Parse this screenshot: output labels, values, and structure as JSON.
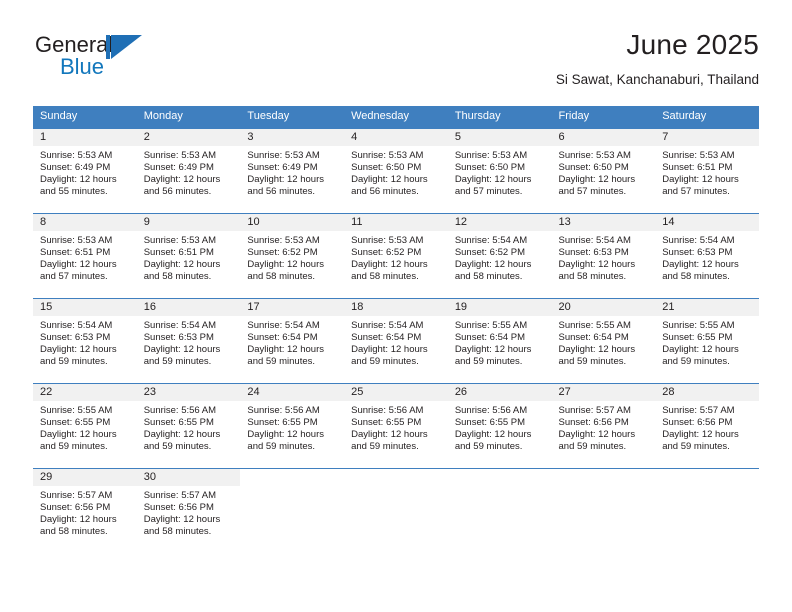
{
  "brand": {
    "name_primary": "General",
    "name_secondary": "Blue",
    "mark": "blue-triangle-logo",
    "color_primary": "#231f20",
    "color_secondary": "#1277bc"
  },
  "header": {
    "title": "June 2025",
    "subtitle": "Si Sawat, Kanchanaburi, Thailand"
  },
  "theme": {
    "header_bg": "#3f7fbf",
    "header_text": "#ffffff",
    "daynum_bg": "#f1f1f1",
    "row_divider": "#3f7fbf",
    "body_text": "#231f20"
  },
  "calendar": {
    "weekdays": [
      "Sunday",
      "Monday",
      "Tuesday",
      "Wednesday",
      "Thursday",
      "Friday",
      "Saturday"
    ],
    "weeks": [
      [
        {
          "day": "1",
          "sunrise": "Sunrise: 5:53 AM",
          "sunset": "Sunset: 6:49 PM",
          "daylight_line1": "Daylight: 12 hours",
          "daylight_line2": "and 55 minutes."
        },
        {
          "day": "2",
          "sunrise": "Sunrise: 5:53 AM",
          "sunset": "Sunset: 6:49 PM",
          "daylight_line1": "Daylight: 12 hours",
          "daylight_line2": "and 56 minutes."
        },
        {
          "day": "3",
          "sunrise": "Sunrise: 5:53 AM",
          "sunset": "Sunset: 6:49 PM",
          "daylight_line1": "Daylight: 12 hours",
          "daylight_line2": "and 56 minutes."
        },
        {
          "day": "4",
          "sunrise": "Sunrise: 5:53 AM",
          "sunset": "Sunset: 6:50 PM",
          "daylight_line1": "Daylight: 12 hours",
          "daylight_line2": "and 56 minutes."
        },
        {
          "day": "5",
          "sunrise": "Sunrise: 5:53 AM",
          "sunset": "Sunset: 6:50 PM",
          "daylight_line1": "Daylight: 12 hours",
          "daylight_line2": "and 57 minutes."
        },
        {
          "day": "6",
          "sunrise": "Sunrise: 5:53 AM",
          "sunset": "Sunset: 6:50 PM",
          "daylight_line1": "Daylight: 12 hours",
          "daylight_line2": "and 57 minutes."
        },
        {
          "day": "7",
          "sunrise": "Sunrise: 5:53 AM",
          "sunset": "Sunset: 6:51 PM",
          "daylight_line1": "Daylight: 12 hours",
          "daylight_line2": "and 57 minutes."
        }
      ],
      [
        {
          "day": "8",
          "sunrise": "Sunrise: 5:53 AM",
          "sunset": "Sunset: 6:51 PM",
          "daylight_line1": "Daylight: 12 hours",
          "daylight_line2": "and 57 minutes."
        },
        {
          "day": "9",
          "sunrise": "Sunrise: 5:53 AM",
          "sunset": "Sunset: 6:51 PM",
          "daylight_line1": "Daylight: 12 hours",
          "daylight_line2": "and 58 minutes."
        },
        {
          "day": "10",
          "sunrise": "Sunrise: 5:53 AM",
          "sunset": "Sunset: 6:52 PM",
          "daylight_line1": "Daylight: 12 hours",
          "daylight_line2": "and 58 minutes."
        },
        {
          "day": "11",
          "sunrise": "Sunrise: 5:53 AM",
          "sunset": "Sunset: 6:52 PM",
          "daylight_line1": "Daylight: 12 hours",
          "daylight_line2": "and 58 minutes."
        },
        {
          "day": "12",
          "sunrise": "Sunrise: 5:54 AM",
          "sunset": "Sunset: 6:52 PM",
          "daylight_line1": "Daylight: 12 hours",
          "daylight_line2": "and 58 minutes."
        },
        {
          "day": "13",
          "sunrise": "Sunrise: 5:54 AM",
          "sunset": "Sunset: 6:53 PM",
          "daylight_line1": "Daylight: 12 hours",
          "daylight_line2": "and 58 minutes."
        },
        {
          "day": "14",
          "sunrise": "Sunrise: 5:54 AM",
          "sunset": "Sunset: 6:53 PM",
          "daylight_line1": "Daylight: 12 hours",
          "daylight_line2": "and 58 minutes."
        }
      ],
      [
        {
          "day": "15",
          "sunrise": "Sunrise: 5:54 AM",
          "sunset": "Sunset: 6:53 PM",
          "daylight_line1": "Daylight: 12 hours",
          "daylight_line2": "and 59 minutes."
        },
        {
          "day": "16",
          "sunrise": "Sunrise: 5:54 AM",
          "sunset": "Sunset: 6:53 PM",
          "daylight_line1": "Daylight: 12 hours",
          "daylight_line2": "and 59 minutes."
        },
        {
          "day": "17",
          "sunrise": "Sunrise: 5:54 AM",
          "sunset": "Sunset: 6:54 PM",
          "daylight_line1": "Daylight: 12 hours",
          "daylight_line2": "and 59 minutes."
        },
        {
          "day": "18",
          "sunrise": "Sunrise: 5:54 AM",
          "sunset": "Sunset: 6:54 PM",
          "daylight_line1": "Daylight: 12 hours",
          "daylight_line2": "and 59 minutes."
        },
        {
          "day": "19",
          "sunrise": "Sunrise: 5:55 AM",
          "sunset": "Sunset: 6:54 PM",
          "daylight_line1": "Daylight: 12 hours",
          "daylight_line2": "and 59 minutes."
        },
        {
          "day": "20",
          "sunrise": "Sunrise: 5:55 AM",
          "sunset": "Sunset: 6:54 PM",
          "daylight_line1": "Daylight: 12 hours",
          "daylight_line2": "and 59 minutes."
        },
        {
          "day": "21",
          "sunrise": "Sunrise: 5:55 AM",
          "sunset": "Sunset: 6:55 PM",
          "daylight_line1": "Daylight: 12 hours",
          "daylight_line2": "and 59 minutes."
        }
      ],
      [
        {
          "day": "22",
          "sunrise": "Sunrise: 5:55 AM",
          "sunset": "Sunset: 6:55 PM",
          "daylight_line1": "Daylight: 12 hours",
          "daylight_line2": "and 59 minutes."
        },
        {
          "day": "23",
          "sunrise": "Sunrise: 5:56 AM",
          "sunset": "Sunset: 6:55 PM",
          "daylight_line1": "Daylight: 12 hours",
          "daylight_line2": "and 59 minutes."
        },
        {
          "day": "24",
          "sunrise": "Sunrise: 5:56 AM",
          "sunset": "Sunset: 6:55 PM",
          "daylight_line1": "Daylight: 12 hours",
          "daylight_line2": "and 59 minutes."
        },
        {
          "day": "25",
          "sunrise": "Sunrise: 5:56 AM",
          "sunset": "Sunset: 6:55 PM",
          "daylight_line1": "Daylight: 12 hours",
          "daylight_line2": "and 59 minutes."
        },
        {
          "day": "26",
          "sunrise": "Sunrise: 5:56 AM",
          "sunset": "Sunset: 6:55 PM",
          "daylight_line1": "Daylight: 12 hours",
          "daylight_line2": "and 59 minutes."
        },
        {
          "day": "27",
          "sunrise": "Sunrise: 5:57 AM",
          "sunset": "Sunset: 6:56 PM",
          "daylight_line1": "Daylight: 12 hours",
          "daylight_line2": "and 59 minutes."
        },
        {
          "day": "28",
          "sunrise": "Sunrise: 5:57 AM",
          "sunset": "Sunset: 6:56 PM",
          "daylight_line1": "Daylight: 12 hours",
          "daylight_line2": "and 59 minutes."
        }
      ],
      [
        {
          "day": "29",
          "sunrise": "Sunrise: 5:57 AM",
          "sunset": "Sunset: 6:56 PM",
          "daylight_line1": "Daylight: 12 hours",
          "daylight_line2": "and 58 minutes."
        },
        {
          "day": "30",
          "sunrise": "Sunrise: 5:57 AM",
          "sunset": "Sunset: 6:56 PM",
          "daylight_line1": "Daylight: 12 hours",
          "daylight_line2": "and 58 minutes."
        },
        {
          "day": "",
          "sunrise": "",
          "sunset": "",
          "daylight_line1": "",
          "daylight_line2": ""
        },
        {
          "day": "",
          "sunrise": "",
          "sunset": "",
          "daylight_line1": "",
          "daylight_line2": ""
        },
        {
          "day": "",
          "sunrise": "",
          "sunset": "",
          "daylight_line1": "",
          "daylight_line2": ""
        },
        {
          "day": "",
          "sunrise": "",
          "sunset": "",
          "daylight_line1": "",
          "daylight_line2": ""
        },
        {
          "day": "",
          "sunrise": "",
          "sunset": "",
          "daylight_line1": "",
          "daylight_line2": ""
        }
      ]
    ]
  }
}
